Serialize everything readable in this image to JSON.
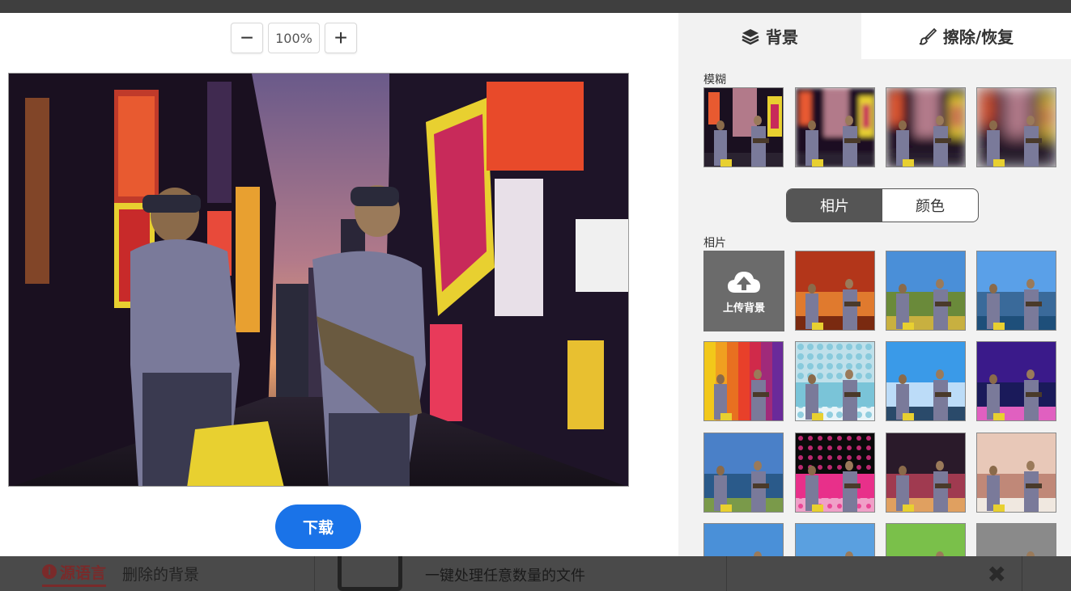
{
  "zoom": {
    "minus": "−",
    "value": "100%",
    "plus": "+"
  },
  "download_label": "下载",
  "tabs": [
    {
      "label": "背景",
      "icon": "layers-icon"
    },
    {
      "label": "擦除/恢复",
      "icon": "brush-icon"
    }
  ],
  "blur_section": {
    "label": "模糊",
    "levels": [
      0,
      1,
      2,
      3
    ]
  },
  "toggle": {
    "photo": "相片",
    "color": "颜色",
    "selected": "相片"
  },
  "photo_section": {
    "label": "相片",
    "upload_label": "上传背景",
    "upload_icon": "cloud-upload-icon",
    "thumbs": [
      {
        "name": "autumn-forest",
        "colors": [
          "#b3361a",
          "#e07a2e",
          "#7a2a10"
        ]
      },
      {
        "name": "mountain-meadow",
        "colors": [
          "#4a8fd8",
          "#6a8a3a",
          "#c8b040"
        ]
      },
      {
        "name": "city-lake",
        "colors": [
          "#5aa0e8",
          "#3a6a9a",
          "#1e4f7a"
        ]
      },
      {
        "name": "rainbow-stripes",
        "colors": [
          "#f2c81a",
          "#e8402a",
          "#8a2a9a"
        ]
      },
      {
        "name": "bokeh",
        "colors": [
          "#bfe0ea",
          "#7ac4d8",
          "#e8f4f8"
        ]
      },
      {
        "name": "shanghai-skyline",
        "colors": [
          "#3a9ae8",
          "#bcdcf8",
          "#2a4a6a"
        ]
      },
      {
        "name": "purple-night",
        "colors": [
          "#3a1a8a",
          "#1a1a5a",
          "#e060c0"
        ]
      },
      {
        "name": "lake-mountains",
        "colors": [
          "#4a80c8",
          "#2a5a8a",
          "#7a9a4a"
        ]
      },
      {
        "name": "pink-dots",
        "colors": [
          "#0a0a0a",
          "#e8308a",
          "#f0a0c8"
        ]
      },
      {
        "name": "neon-street",
        "colors": [
          "#2a1a2a",
          "#a03a50",
          "#e0a060"
        ]
      },
      {
        "name": "sunset-clouds",
        "colors": [
          "#e8c8b8",
          "#c08878",
          "#f0e8e0"
        ]
      },
      {
        "name": "blue-sky",
        "colors": [
          "#4a90d8",
          "#a8cce8",
          "#e8f0f8"
        ]
      },
      {
        "name": "golden-gate",
        "colors": [
          "#5aa0e0",
          "#c04a2a",
          "#9ac0e0"
        ]
      },
      {
        "name": "colorful-balls",
        "colors": [
          "#7ac04a",
          "#c83a8a",
          "#e8c83a"
        ]
      },
      {
        "name": "city-buildings",
        "colors": [
          "#8a8a8a",
          "#d0d0d0",
          "#5a5a5a"
        ]
      }
    ]
  },
  "background_page": {
    "source_lang_tab": "源语言",
    "removed_bg_tab": "删除的背景",
    "card_text": "一键处理任意数量的文件",
    "close": "✖"
  },
  "colors": {
    "accent": "#1a73e8",
    "panel": "#f2f2f2",
    "toggle_on": "#555555",
    "upload_tile": "#6b6b6b"
  }
}
